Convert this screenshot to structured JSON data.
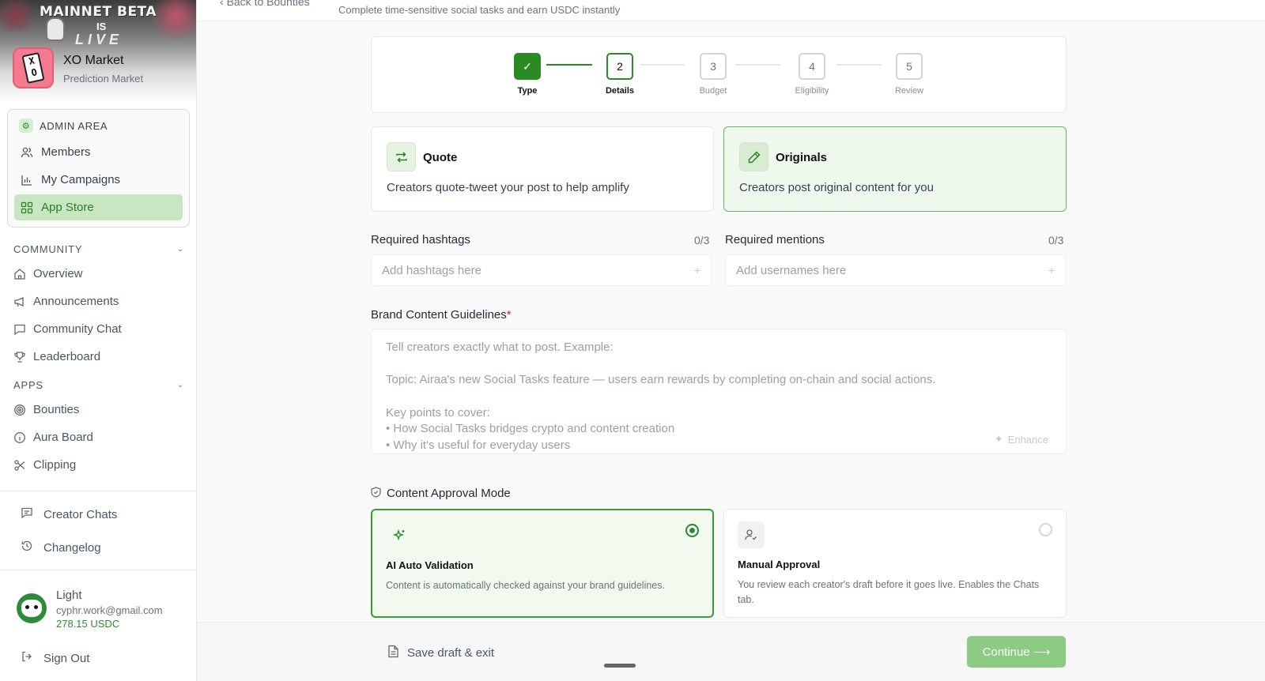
{
  "banner": {
    "line1": "MAINNET BETA",
    "line2": "IS",
    "line3": "LIVE"
  },
  "org": {
    "name": "XO Market",
    "subtitle": "Prediction Market",
    "logo_text": "X O"
  },
  "admin": {
    "heading": "ADMIN AREA",
    "items": [
      {
        "label": "Members",
        "icon": "users-icon"
      },
      {
        "label": "My Campaigns",
        "icon": "bar-chart-icon"
      },
      {
        "label": "App Store",
        "icon": "grid-icon",
        "active": true
      }
    ]
  },
  "community": {
    "heading": "COMMUNITY",
    "items": [
      {
        "label": "Overview",
        "icon": "home-icon"
      },
      {
        "label": "Announcements",
        "icon": "megaphone-icon"
      },
      {
        "label": "Community Chat",
        "icon": "chat-icon"
      },
      {
        "label": "Leaderboard",
        "icon": "trophy-icon"
      }
    ]
  },
  "apps": {
    "heading": "APPS",
    "items": [
      {
        "label": "Bounties",
        "icon": "target-icon"
      },
      {
        "label": "Aura Board",
        "icon": "info-icon"
      },
      {
        "label": "Clipping",
        "icon": "scissors-icon"
      }
    ]
  },
  "footer_nav": {
    "creator_chats": "Creator Chats",
    "changelog": "Changelog",
    "sign_out": "Sign Out"
  },
  "user": {
    "name": "Light",
    "email": "cyphr.work@gmail.com",
    "balance": "278.15 USDC"
  },
  "header": {
    "back_label": "Back to Bounties",
    "subtitle": "Complete time-sensitive social tasks and earn USDC instantly"
  },
  "stepper": {
    "steps": [
      {
        "num": "✓",
        "label": "Type",
        "state": "done"
      },
      {
        "num": "2",
        "label": "Details",
        "state": "current"
      },
      {
        "num": "3",
        "label": "Budget",
        "state": "pending"
      },
      {
        "num": "4",
        "label": "Eligibility",
        "state": "pending"
      },
      {
        "num": "5",
        "label": "Review",
        "state": "pending"
      }
    ]
  },
  "task_types": [
    {
      "title": "Quote",
      "desc": "Creators quote-tweet your post to help amplify",
      "icon": "repost-icon",
      "selected": false
    },
    {
      "title": "Originals",
      "desc": "Creators post original content for you",
      "icon": "pencil-icon",
      "selected": true
    }
  ],
  "hashtags": {
    "label": "Required hashtags",
    "count": "0/3",
    "placeholder": "Add hashtags here"
  },
  "mentions": {
    "label": "Required mentions",
    "count": "0/3",
    "placeholder": "Add usernames here"
  },
  "guidelines": {
    "label": "Brand Content Guidelines",
    "required_mark": "*",
    "placeholder_lines": [
      "Tell creators exactly what to post. Example:",
      "Topic: Airaa's new Social Tasks feature — users earn rewards by completing on-chain and social actions.",
      "Key points to cover:",
      "• How Social Tasks bridges crypto and content creation",
      "• Why it's useful for everyday users"
    ],
    "enhance_label": "Enhance"
  },
  "approval": {
    "label": "Content Approval Mode",
    "options": [
      {
        "title": "AI Auto Validation",
        "desc": "Content is automatically checked against your brand guidelines.",
        "icon": "sparkle-icon",
        "selected": true
      },
      {
        "title": "Manual Approval",
        "desc": "You review each creator's draft before it goes live. Enables the Chats tab.",
        "icon": "user-check-icon",
        "selected": false
      }
    ]
  },
  "actions": {
    "save_draft": "Save draft & exit",
    "continue": "Continue ⟶"
  },
  "colors": {
    "accent": "#2a8b23",
    "accent_light": "#c8e6c2",
    "continue_bg": "#8ccb83",
    "logo_bg": "#f47b8f"
  }
}
